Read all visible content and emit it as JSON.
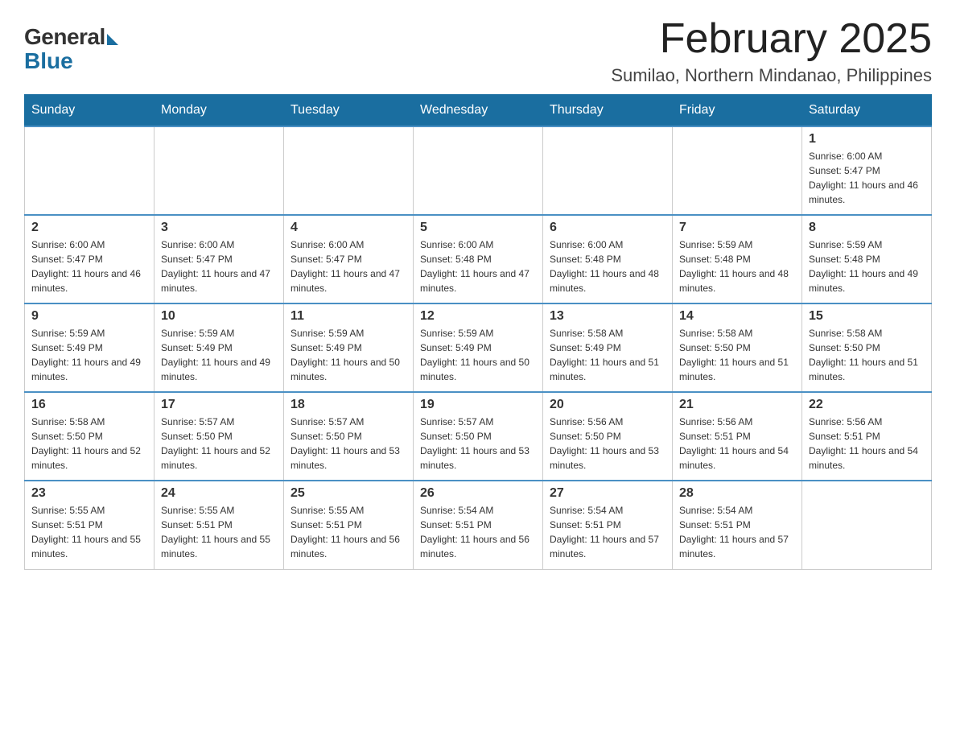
{
  "header": {
    "logo": {
      "general": "General",
      "blue": "Blue"
    },
    "month_title": "February 2025",
    "location": "Sumilao, Northern Mindanao, Philippines"
  },
  "days_of_week": [
    "Sunday",
    "Monday",
    "Tuesday",
    "Wednesday",
    "Thursday",
    "Friday",
    "Saturday"
  ],
  "weeks": [
    {
      "days": [
        {
          "num": "",
          "empty": true
        },
        {
          "num": "",
          "empty": true
        },
        {
          "num": "",
          "empty": true
        },
        {
          "num": "",
          "empty": true
        },
        {
          "num": "",
          "empty": true
        },
        {
          "num": "",
          "empty": true
        },
        {
          "num": "1",
          "sunrise": "Sunrise: 6:00 AM",
          "sunset": "Sunset: 5:47 PM",
          "daylight": "Daylight: 11 hours and 46 minutes."
        }
      ]
    },
    {
      "days": [
        {
          "num": "2",
          "sunrise": "Sunrise: 6:00 AM",
          "sunset": "Sunset: 5:47 PM",
          "daylight": "Daylight: 11 hours and 46 minutes."
        },
        {
          "num": "3",
          "sunrise": "Sunrise: 6:00 AM",
          "sunset": "Sunset: 5:47 PM",
          "daylight": "Daylight: 11 hours and 47 minutes."
        },
        {
          "num": "4",
          "sunrise": "Sunrise: 6:00 AM",
          "sunset": "Sunset: 5:47 PM",
          "daylight": "Daylight: 11 hours and 47 minutes."
        },
        {
          "num": "5",
          "sunrise": "Sunrise: 6:00 AM",
          "sunset": "Sunset: 5:48 PM",
          "daylight": "Daylight: 11 hours and 47 minutes."
        },
        {
          "num": "6",
          "sunrise": "Sunrise: 6:00 AM",
          "sunset": "Sunset: 5:48 PM",
          "daylight": "Daylight: 11 hours and 48 minutes."
        },
        {
          "num": "7",
          "sunrise": "Sunrise: 5:59 AM",
          "sunset": "Sunset: 5:48 PM",
          "daylight": "Daylight: 11 hours and 48 minutes."
        },
        {
          "num": "8",
          "sunrise": "Sunrise: 5:59 AM",
          "sunset": "Sunset: 5:48 PM",
          "daylight": "Daylight: 11 hours and 49 minutes."
        }
      ]
    },
    {
      "days": [
        {
          "num": "9",
          "sunrise": "Sunrise: 5:59 AM",
          "sunset": "Sunset: 5:49 PM",
          "daylight": "Daylight: 11 hours and 49 minutes."
        },
        {
          "num": "10",
          "sunrise": "Sunrise: 5:59 AM",
          "sunset": "Sunset: 5:49 PM",
          "daylight": "Daylight: 11 hours and 49 minutes."
        },
        {
          "num": "11",
          "sunrise": "Sunrise: 5:59 AM",
          "sunset": "Sunset: 5:49 PM",
          "daylight": "Daylight: 11 hours and 50 minutes."
        },
        {
          "num": "12",
          "sunrise": "Sunrise: 5:59 AM",
          "sunset": "Sunset: 5:49 PM",
          "daylight": "Daylight: 11 hours and 50 minutes."
        },
        {
          "num": "13",
          "sunrise": "Sunrise: 5:58 AM",
          "sunset": "Sunset: 5:49 PM",
          "daylight": "Daylight: 11 hours and 51 minutes."
        },
        {
          "num": "14",
          "sunrise": "Sunrise: 5:58 AM",
          "sunset": "Sunset: 5:50 PM",
          "daylight": "Daylight: 11 hours and 51 minutes."
        },
        {
          "num": "15",
          "sunrise": "Sunrise: 5:58 AM",
          "sunset": "Sunset: 5:50 PM",
          "daylight": "Daylight: 11 hours and 51 minutes."
        }
      ]
    },
    {
      "days": [
        {
          "num": "16",
          "sunrise": "Sunrise: 5:58 AM",
          "sunset": "Sunset: 5:50 PM",
          "daylight": "Daylight: 11 hours and 52 minutes."
        },
        {
          "num": "17",
          "sunrise": "Sunrise: 5:57 AM",
          "sunset": "Sunset: 5:50 PM",
          "daylight": "Daylight: 11 hours and 52 minutes."
        },
        {
          "num": "18",
          "sunrise": "Sunrise: 5:57 AM",
          "sunset": "Sunset: 5:50 PM",
          "daylight": "Daylight: 11 hours and 53 minutes."
        },
        {
          "num": "19",
          "sunrise": "Sunrise: 5:57 AM",
          "sunset": "Sunset: 5:50 PM",
          "daylight": "Daylight: 11 hours and 53 minutes."
        },
        {
          "num": "20",
          "sunrise": "Sunrise: 5:56 AM",
          "sunset": "Sunset: 5:50 PM",
          "daylight": "Daylight: 11 hours and 53 minutes."
        },
        {
          "num": "21",
          "sunrise": "Sunrise: 5:56 AM",
          "sunset": "Sunset: 5:51 PM",
          "daylight": "Daylight: 11 hours and 54 minutes."
        },
        {
          "num": "22",
          "sunrise": "Sunrise: 5:56 AM",
          "sunset": "Sunset: 5:51 PM",
          "daylight": "Daylight: 11 hours and 54 minutes."
        }
      ]
    },
    {
      "days": [
        {
          "num": "23",
          "sunrise": "Sunrise: 5:55 AM",
          "sunset": "Sunset: 5:51 PM",
          "daylight": "Daylight: 11 hours and 55 minutes."
        },
        {
          "num": "24",
          "sunrise": "Sunrise: 5:55 AM",
          "sunset": "Sunset: 5:51 PM",
          "daylight": "Daylight: 11 hours and 55 minutes."
        },
        {
          "num": "25",
          "sunrise": "Sunrise: 5:55 AM",
          "sunset": "Sunset: 5:51 PM",
          "daylight": "Daylight: 11 hours and 56 minutes."
        },
        {
          "num": "26",
          "sunrise": "Sunrise: 5:54 AM",
          "sunset": "Sunset: 5:51 PM",
          "daylight": "Daylight: 11 hours and 56 minutes."
        },
        {
          "num": "27",
          "sunrise": "Sunrise: 5:54 AM",
          "sunset": "Sunset: 5:51 PM",
          "daylight": "Daylight: 11 hours and 57 minutes."
        },
        {
          "num": "28",
          "sunrise": "Sunrise: 5:54 AM",
          "sunset": "Sunset: 5:51 PM",
          "daylight": "Daylight: 11 hours and 57 minutes."
        },
        {
          "num": "",
          "empty": true
        }
      ]
    }
  ]
}
